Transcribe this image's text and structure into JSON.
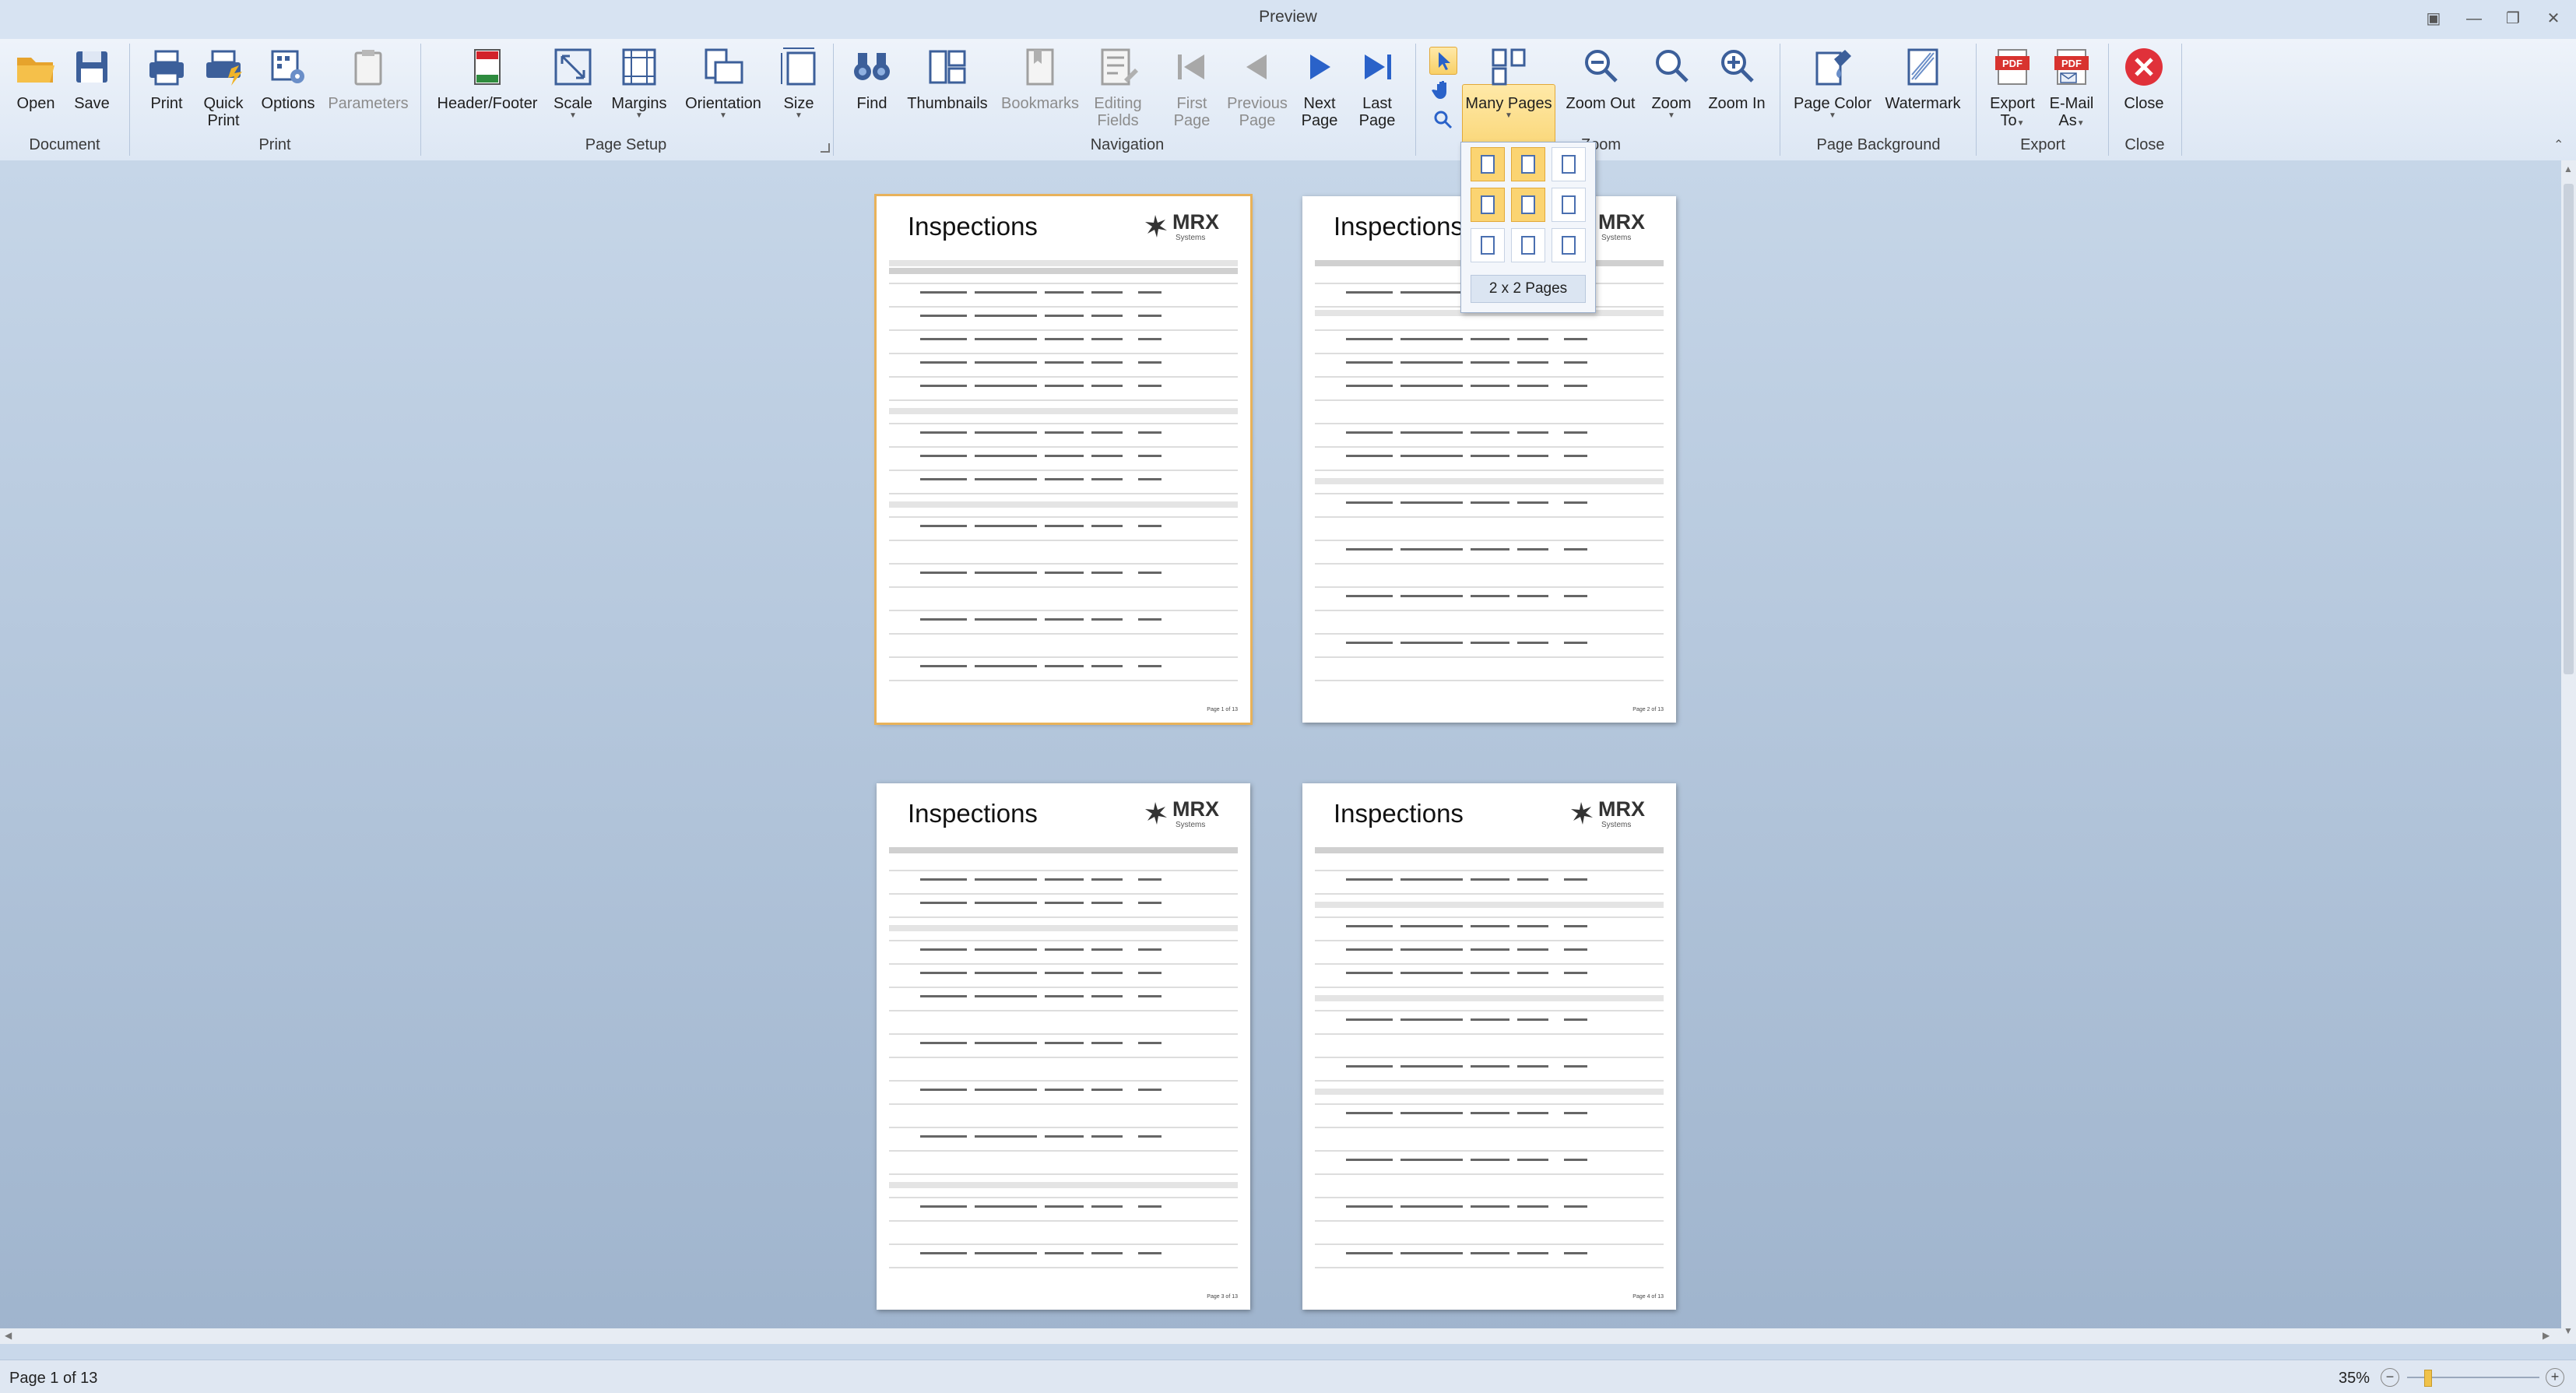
{
  "window": {
    "title": "Preview"
  },
  "ribbon": {
    "groups": {
      "document": "Document",
      "print": "Print",
      "page_setup": "Page Setup",
      "navigation": "Navigation",
      "zoom": "Zoom",
      "page_background": "Page Background",
      "export": "Export",
      "close": "Close"
    },
    "buttons": {
      "open": "Open",
      "save": "Save",
      "print": "Print",
      "quick_print_1": "Quick",
      "quick_print_2": "Print",
      "options": "Options",
      "parameters": "Parameters",
      "header_footer": "Header/Footer",
      "scale": "Scale",
      "margins": "Margins",
      "orientation": "Orientation",
      "size": "Size",
      "find": "Find",
      "thumbnails": "Thumbnails",
      "bookmarks": "Bookmarks",
      "editing_fields_1": "Editing",
      "editing_fields_2": "Fields",
      "first_page_1": "First",
      "first_page_2": "Page",
      "previous_page_1": "Previous",
      "previous_page_2": "Page",
      "next_page_1": "Next",
      "next_page_2": "Page",
      "last_page_1": "Last",
      "last_page_2": "Page",
      "many_pages": "Many Pages",
      "zoom_out": "Zoom Out",
      "zoom": "Zoom",
      "zoom_in": "Zoom In",
      "page_color": "Page Color",
      "watermark": "Watermark",
      "export_to_1": "Export",
      "export_to_2": "To",
      "email_as_1": "E-Mail",
      "email_as_2": "As",
      "close": "Close"
    }
  },
  "many_pages_dropdown": {
    "selected_label": "2 x 2 Pages",
    "selected_cols": 2,
    "selected_rows": 2
  },
  "pages": [
    {
      "title": "Inspections",
      "logo": "MRX",
      "logo_sub": "Systems",
      "footer_right": "Page 1 of 13"
    },
    {
      "title": "Inspections",
      "logo": "MRX",
      "logo_sub": "Systems",
      "footer_right": "Page 2 of 13"
    },
    {
      "title": "Inspections",
      "logo": "MRX",
      "logo_sub": "Systems",
      "footer_right": "Page 3 of 13"
    },
    {
      "title": "Inspections",
      "logo": "MRX",
      "logo_sub": "Systems",
      "footer_right": "Page 4 of 13"
    }
  ],
  "status": {
    "page_info": "Page 1 of 13",
    "zoom": "35%"
  },
  "colors": {
    "accent": "#f8d067",
    "close_red": "#e0313a",
    "nav_blue": "#2a62c9",
    "pdf_red": "#d8332f"
  }
}
